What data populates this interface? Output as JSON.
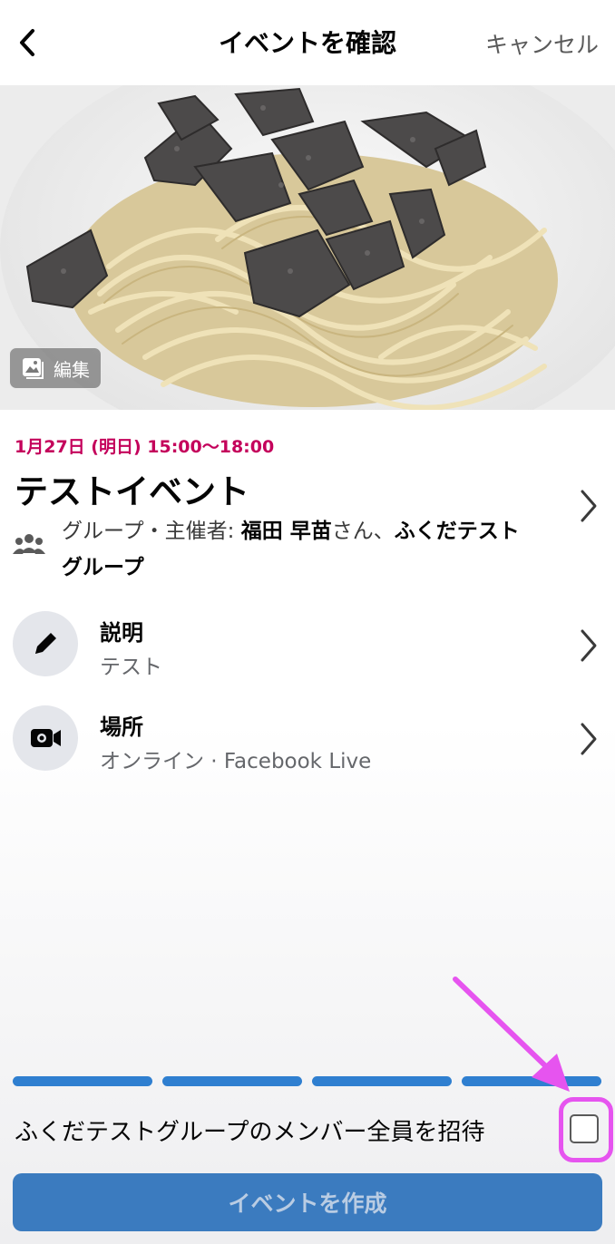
{
  "header": {
    "title": "イベントを確認",
    "cancel_label": "キャンセル"
  },
  "cover": {
    "edit_label": "編集"
  },
  "event": {
    "date": "1月27日 (明日) 15:00〜18:00",
    "title": "テストイベント",
    "group_prefix": "グループ・主催者: ",
    "host_name": "福田 早苗",
    "host_suffix": "さん、",
    "group_name_line1": "ふくだテスト",
    "group_name_line2": "グループ"
  },
  "rows": [
    {
      "label": "説明",
      "sub": "テスト",
      "icon": "pencil-icon"
    },
    {
      "label": "場所",
      "sub": "オンライン · Facebook Live",
      "icon": "video-camera-icon"
    }
  ],
  "progress": {
    "total_steps": 4,
    "completed_steps": 4
  },
  "invite": {
    "label": "ふくだテストグループのメンバー全員を招待",
    "checked": false
  },
  "footer": {
    "create_label": "イベントを作成"
  },
  "colors": {
    "accent": "#3b7bbf",
    "date_color": "#c4005b",
    "annotation": "#e654ef"
  }
}
